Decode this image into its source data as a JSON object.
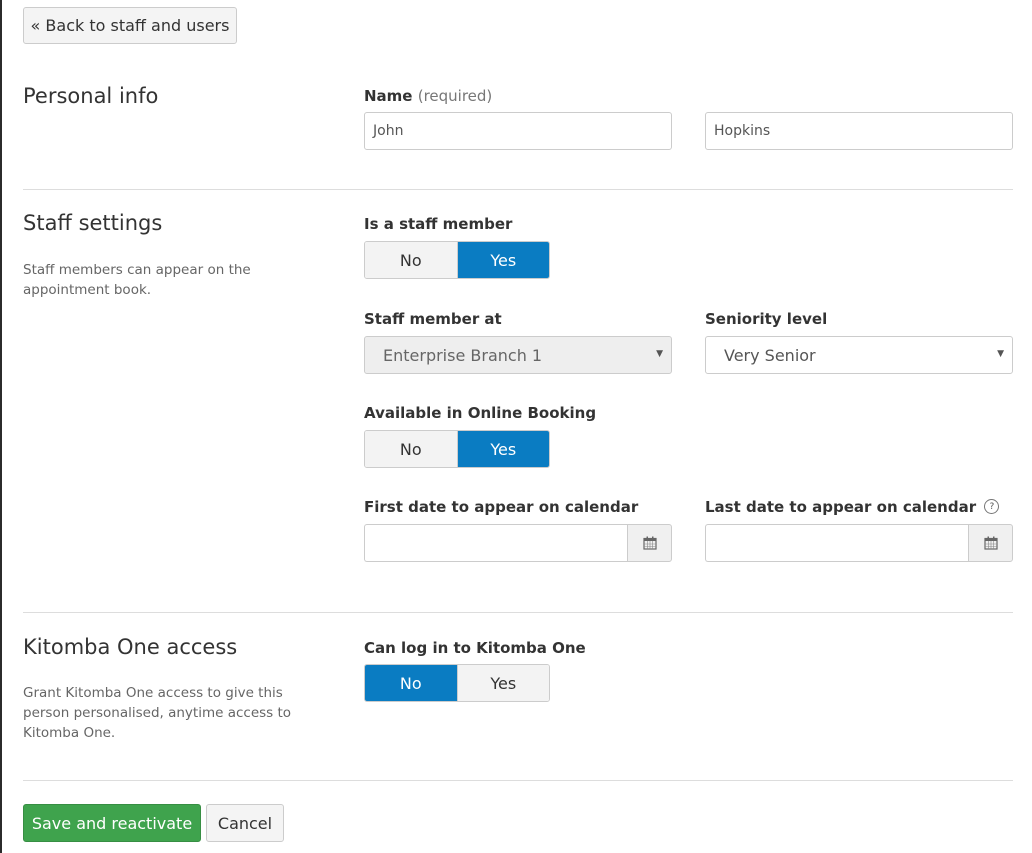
{
  "back_button": {
    "label": "« Back to staff and users"
  },
  "personal_info": {
    "title": "Personal info",
    "name_label": "Name",
    "name_hint": "(required)",
    "first_name": "John",
    "last_name": "Hopkins"
  },
  "staff_settings": {
    "title": "Staff settings",
    "description": "Staff members can appear on the appointment book.",
    "is_staff": {
      "label": "Is a staff member",
      "options": [
        "No",
        "Yes"
      ],
      "selected": "Yes"
    },
    "staff_member_at": {
      "label": "Staff member at",
      "value": "Enterprise Branch 1",
      "disabled": true
    },
    "seniority": {
      "label": "Seniority level",
      "value": "Very Senior"
    },
    "online_booking": {
      "label": "Available in Online Booking",
      "options": [
        "No",
        "Yes"
      ],
      "selected": "Yes"
    },
    "first_date": {
      "label": "First date to appear on calendar",
      "value": ""
    },
    "last_date": {
      "label": "Last date to appear on calendar",
      "value": "",
      "help": "?"
    }
  },
  "kitomba_access": {
    "title": "Kitomba One access",
    "description": "Grant Kitomba One access to give this person personalised, anytime access to Kitomba One.",
    "can_login": {
      "label": "Can log in to Kitomba One",
      "options": [
        "No",
        "Yes"
      ],
      "selected": "No"
    }
  },
  "actions": {
    "save_label": "Save and reactivate",
    "cancel_label": "Cancel"
  },
  "colors": {
    "accent": "#0a7cc2",
    "save": "#3fa34d"
  },
  "icons": {
    "calendar": "calendar-icon",
    "help": "help-icon",
    "caret": "caret-down-icon"
  }
}
